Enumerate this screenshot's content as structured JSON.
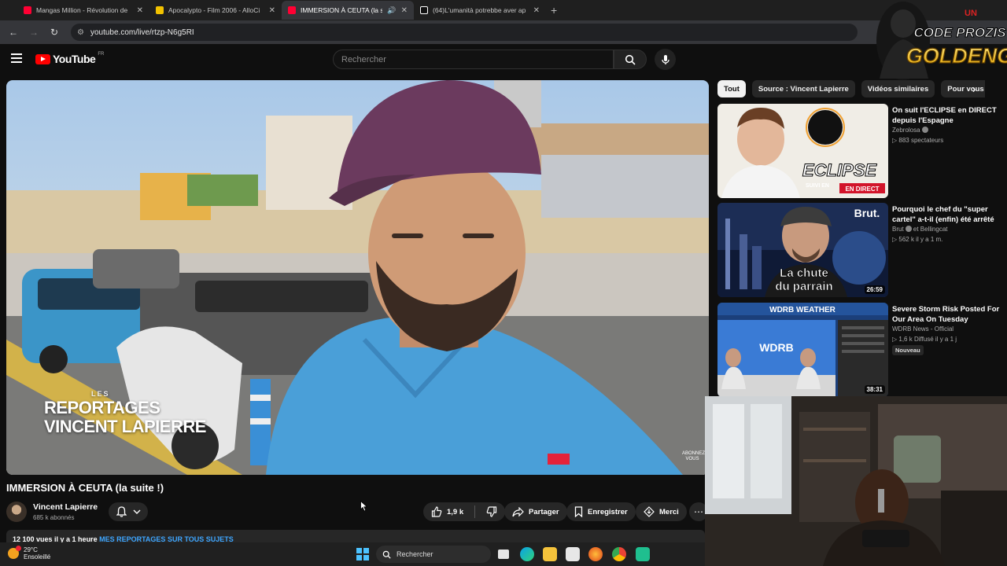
{
  "browser": {
    "tabs": [
      {
        "title": "Mangas Million - Révolution de",
        "favicon_color": "#ff0033"
      },
      {
        "title": "Apocalypto - Film 2006 - AlloCi",
        "favicon_color": "#f2c200"
      },
      {
        "title": "IMMERSION À CEUTA (la su",
        "favicon_color": "#ff0033",
        "active": true
      },
      {
        "title": "(64)L'umanità potrebbe aver ap",
        "favicon_color": "#ffffff"
      }
    ],
    "new_tab": "+",
    "url": "youtube.com/live/rtzp-N6g5RI"
  },
  "youtube": {
    "logo_word": "YouTube",
    "logo_region": "FR",
    "search_placeholder": "Rechercher"
  },
  "overlay_logo": {
    "line1": "UN",
    "line2": "CODE PROZIS",
    "line3": "GOLDENG"
  },
  "player": {
    "watermark": {
      "line1": "LES",
      "line2": "REPORTAGES",
      "line3": "VINCENT LAPIERRE"
    },
    "corner_label": "ABONNEZ VOUS"
  },
  "video": {
    "title": "IMMERSION À CEUTA (la suite !)",
    "channel": "Vincent Lapierre",
    "subscribers": "685 k abonnés",
    "likes": "1,9 k",
    "share": "Partager",
    "save": "Enregistrer",
    "thanks": "Merci",
    "description_views": "12 100 vues  il y a 1 heure",
    "description_tag": "MES REPORTAGES SUR TOUS SUJETS"
  },
  "sidebar": {
    "chips": [
      "Tout",
      "Source : Vincent Lapierre",
      "Vidéos similaires",
      "Pour vous"
    ],
    "recommendations": [
      {
        "title": "On suit l'ECLIPSE en DIRECT depuis l'Espagne",
        "channel": "Zebrolosa",
        "meta": "▷ 883 spectateurs",
        "thumb_text": "ECLIPSE",
        "thumb_sub": "SUIVI EN",
        "live_badge": "EN DIRECT"
      },
      {
        "title": "Pourquoi le chef du \"super cartel\" a-t-il (enfin) été arrêté",
        "channel": "Brut",
        "channel_suffix": "et Bellingcat",
        "meta": "▷ 562 k   il y a 1 m.",
        "thumb_brand": "Brut.",
        "thumb_line1": "La chute",
        "thumb_line2": "du parrain",
        "duration": "26:59"
      },
      {
        "title": "Severe Storm Risk Posted For Our Area On Tuesday",
        "channel": "WDRB News - Official",
        "meta": "▷ 1,6 k   Diffusé il y a 1 j",
        "badge": "Nouveau",
        "thumb_header": "WDRB WEATHER",
        "thumb_logo": "WDRB",
        "duration": "38:31"
      }
    ]
  },
  "taskbar": {
    "temperature": "29°C",
    "weather": "Ensoleillé",
    "search_label": "Rechercher"
  }
}
